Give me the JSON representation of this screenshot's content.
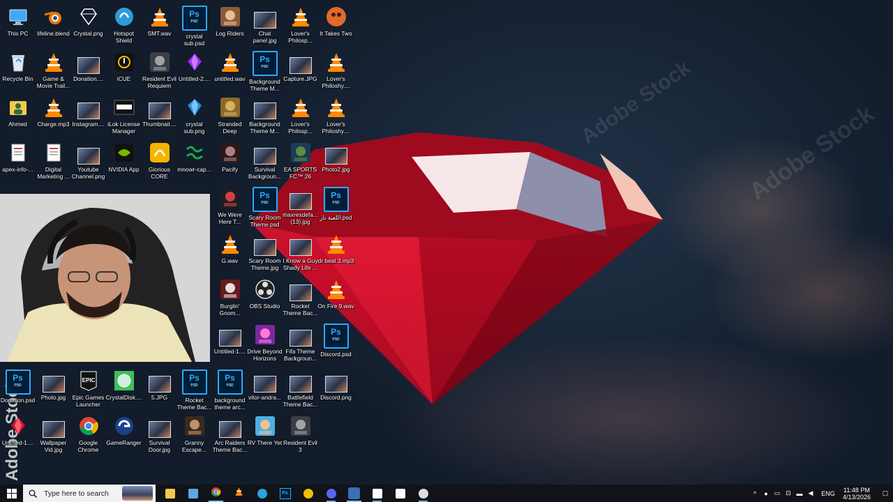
{
  "desktop": {
    "icons": [
      {
        "label": "This PC",
        "icon": "this-pc-icon"
      },
      {
        "label": "lifeline.blend",
        "icon": "blender-icon"
      },
      {
        "label": "Crystal.png",
        "icon": "crystal-png-icon"
      },
      {
        "label": "Hotspot Shield",
        "icon": "hotspot-shield-icon"
      },
      {
        "label": "SMT.wav",
        "icon": "vlc-icon"
      },
      {
        "label": "crystal sub.psd",
        "icon": "photoshop-file-icon"
      },
      {
        "label": "Log Riders",
        "icon": "log-riders-icon"
      },
      {
        "label": "Chat panel.jpg",
        "icon": "image-file-icon"
      },
      {
        "label": "Lover's Philosp...",
        "icon": "vlc-icon"
      },
      {
        "label": "It Takes Two",
        "icon": "it-takes-two-icon"
      },
      {
        "label": "Recycle Bin",
        "icon": "recycle-bin-icon"
      },
      {
        "label": "Game & Movie Trail...",
        "icon": "vlc-icon"
      },
      {
        "label": "Donation....",
        "icon": "image-file-icon"
      },
      {
        "label": "iCUE",
        "icon": "icue-icon"
      },
      {
        "label": "Resident Evil Requiem",
        "icon": "resident-evil-icon"
      },
      {
        "label": "Untitled-2....",
        "icon": "purple-gem-icon"
      },
      {
        "label": "untitled.wav",
        "icon": "vlc-icon"
      },
      {
        "label": "Background Theme M...",
        "icon": "photoshop-file-icon"
      },
      {
        "label": "Capture.JPG",
        "icon": "image-file-icon"
      },
      {
        "label": "Lover's Philoshy....",
        "icon": "vlc-icon"
      },
      {
        "label": "Ahmed",
        "icon": "user-folder-icon"
      },
      {
        "label": "Charge.mp3",
        "icon": "vlc-icon"
      },
      {
        "label": "Instagram....",
        "icon": "image-file-icon"
      },
      {
        "label": "iLok License Manager",
        "icon": "ilok-icon"
      },
      {
        "label": "Thumbnail....",
        "icon": "image-file-icon"
      },
      {
        "label": "crystal sub.png",
        "icon": "blue-crystal-icon"
      },
      {
        "label": "Stranded Deep",
        "icon": "stranded-deep-icon"
      },
      {
        "label": "Background Theme M...",
        "icon": "image-file-icon"
      },
      {
        "label": "Lover's Philosp...",
        "icon": "vlc-icon"
      },
      {
        "label": "Lover's Philoshy....",
        "icon": "vlc-icon"
      },
      {
        "label": "apex-info-...",
        "icon": "document-icon"
      },
      {
        "label": "Digital Marketing ...",
        "icon": "document-icon"
      },
      {
        "label": "Youtube Channel.png",
        "icon": "image-file-icon"
      },
      {
        "label": "NVIDIA App",
        "icon": "nvidia-icon"
      },
      {
        "label": "Glorious CORE",
        "icon": "glorious-core-icon"
      },
      {
        "label": "mnowr-cap...",
        "icon": "arabic-logo-icon"
      },
      {
        "label": "Pacify",
        "icon": "pacify-icon"
      },
      {
        "label": "Survival Backgroun...",
        "icon": "image-file-icon"
      },
      {
        "label": "EA SPORTS FC™ 26",
        "icon": "ea-sports-icon"
      },
      {
        "label": "Photo2.jpg",
        "icon": "image-file-icon"
      },
      {
        "label": "We Were Here T...",
        "icon": "we-were-here-icon"
      },
      {
        "label": "Scary Room Theme.psd",
        "icon": "photoshop-file-icon"
      },
      {
        "label": "maxresdefa... (13).jpg",
        "icon": "image-file-icon"
      },
      {
        "label": "اللعبة نار.psd",
        "icon": "photoshop-file-icon"
      },
      {
        "label": "G.wav",
        "icon": "vlc-icon"
      },
      {
        "label": "Scary Room Theme.jpg",
        "icon": "image-file-icon"
      },
      {
        "label": "I Know a Guy Shady Life ...",
        "icon": "image-file-icon"
      },
      {
        "label": "dr beat 3.mp3",
        "icon": "vlc-icon"
      },
      {
        "label": "Burglin' Gnom...",
        "icon": "burglin-gnomes-icon"
      },
      {
        "label": "OBS Studio",
        "icon": "obs-icon"
      },
      {
        "label": "Rocket Theme Bac...",
        "icon": "image-file-icon"
      },
      {
        "label": "On Fire 9.wav",
        "icon": "vlc-icon"
      },
      {
        "label": "Untitled-1....",
        "icon": "image-file-icon"
      },
      {
        "label": "Drive Beyond Horizons",
        "icon": "drive-beyond-icon"
      },
      {
        "label": "Fifa Theme Backgroun...",
        "icon": "image-file-icon"
      },
      {
        "label": "Discord.psd",
        "icon": "photoshop-file-icon"
      },
      {
        "label": "Donation.psd",
        "icon": "photoshop-file-icon"
      },
      {
        "label": "Photo.jpg",
        "icon": "image-file-icon"
      },
      {
        "label": "Epic Games Launcher",
        "icon": "epic-games-icon"
      },
      {
        "label": "CrystalDisk....",
        "icon": "crystaldisk-icon"
      },
      {
        "label": "5.JPG",
        "icon": "image-file-icon"
      },
      {
        "label": "Rocket Theme Bac...",
        "icon": "photoshop-file-icon"
      },
      {
        "label": "background theme arc...",
        "icon": "photoshop-file-icon"
      },
      {
        "label": "vitor-andra...",
        "icon": "image-file-icon"
      },
      {
        "label": "Battlefield Theme Bac...",
        "icon": "image-file-icon"
      },
      {
        "label": "Discord.png",
        "icon": "image-file-icon"
      },
      {
        "label": "Untitled-1....",
        "icon": "red-gem-icon"
      },
      {
        "label": "Wallpaper Vid.jpg",
        "icon": "image-file-icon"
      },
      {
        "label": "Google Chrome",
        "icon": "chrome-icon"
      },
      {
        "label": "GameRanger",
        "icon": "gameranger-icon"
      },
      {
        "label": "Survival Door.jpg",
        "icon": "image-file-icon"
      },
      {
        "label": "Granny Escape...",
        "icon": "granny-icon"
      },
      {
        "label": "Arc Raiders Theme Bac...",
        "icon": "image-file-icon"
      },
      {
        "label": "RV There Yet",
        "icon": "rv-there-yet-icon"
      },
      {
        "label": "Resident Evil 3",
        "icon": "resident-evil-icon"
      }
    ]
  },
  "wallpaper": {
    "watermark": "Adobe Stock",
    "colors": {
      "gem": "#d0122e",
      "gem_light": "#ff4a62",
      "bg": "#1a2536"
    }
  },
  "taskbar": {
    "search_placeholder": "Type here to search",
    "apps": [
      {
        "name": "file-explorer-icon"
      },
      {
        "name": "app-window-icon"
      },
      {
        "name": "chrome-taskbar-icon"
      },
      {
        "name": "vlc-taskbar-icon"
      },
      {
        "name": "telegram-icon"
      },
      {
        "name": "photoshop-taskbar-icon"
      },
      {
        "name": "corsair-icon"
      },
      {
        "name": "discord-icon"
      },
      {
        "name": "steam-icon"
      },
      {
        "name": "capcut-icon"
      },
      {
        "name": "capcut-alt-icon"
      },
      {
        "name": "obs-taskbar-icon"
      }
    ],
    "tray": {
      "language": "ENG",
      "time": "11:48 PM",
      "date": "4/13/2026"
    }
  }
}
